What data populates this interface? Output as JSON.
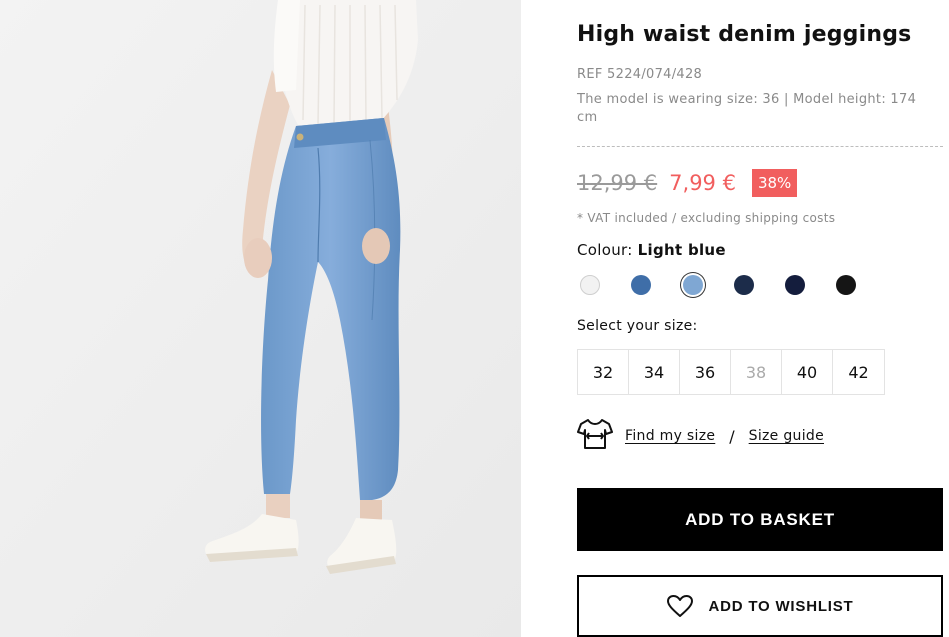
{
  "product": {
    "title": "High waist denim jeggings",
    "ref": "REF 5224/074/428",
    "model_info": "The model is wearing size: 36 | Model height: 174 cm",
    "image_icon": "product-photo-jeans"
  },
  "pricing": {
    "old_price": "12,99 €",
    "new_price": "7,99 €",
    "discount": "38%",
    "vat_note": "* VAT included / excluding shipping costs",
    "sale_color": "#f15e5e"
  },
  "colour": {
    "label": "Colour:",
    "selected": "Light blue",
    "swatches": [
      {
        "name": "White",
        "color": "#f2f2f2"
      },
      {
        "name": "Mid blue",
        "color": "#3f6ea8"
      },
      {
        "name": "Light blue",
        "color": "#7fa7d3",
        "selected": true
      },
      {
        "name": "Dark blue",
        "color": "#1c2c4a"
      },
      {
        "name": "Navy",
        "color": "#141d3d"
      },
      {
        "name": "Black",
        "color": "#151515"
      }
    ]
  },
  "size": {
    "label": "Select your size:",
    "options": [
      {
        "value": "32",
        "available": true
      },
      {
        "value": "34",
        "available": true
      },
      {
        "value": "36",
        "available": true
      },
      {
        "value": "38",
        "available": false
      },
      {
        "value": "40",
        "available": true
      },
      {
        "value": "42",
        "available": true
      }
    ]
  },
  "fit": {
    "icon": "tshirt-measure-icon",
    "find_my_size": "Find my size",
    "separator": "/",
    "size_guide": "Size guide"
  },
  "actions": {
    "add_to_basket": "ADD TO BASKET",
    "add_to_wishlist": "ADD TO WISHLIST",
    "wishlist_icon": "heart-icon"
  }
}
